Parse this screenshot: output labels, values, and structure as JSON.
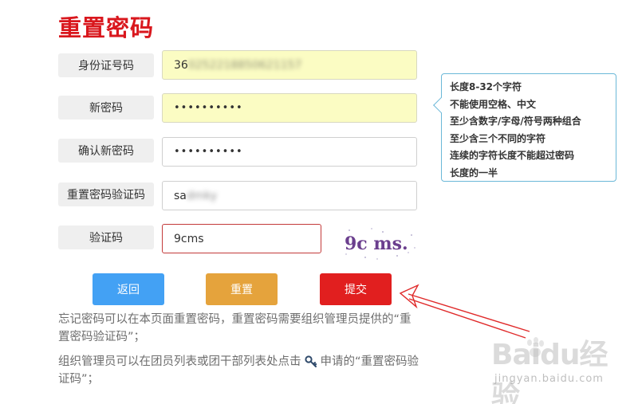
{
  "page": {
    "title": "重置密码"
  },
  "form": {
    "id_card": {
      "label": "身份证号码",
      "value": "36",
      "masked": "0252218850621157"
    },
    "new_password": {
      "label": "新密码",
      "value": "••••••••••"
    },
    "confirm_password": {
      "label": "确认新密码",
      "value": "••••••••••"
    },
    "reset_code": {
      "label": "重置密码验证码",
      "value": "sa",
      "masked": "dmky"
    },
    "captcha": {
      "label": "验证码",
      "value": "9cms",
      "image_text": "9c ms."
    }
  },
  "tooltip": {
    "lines": [
      "长度8-32个字符",
      "不能使用空格、中文",
      "至少含数字/字母/符号两种组合",
      "至少含三个不同的字符",
      "连续的字符长度不能超过密码",
      "长度的一半"
    ]
  },
  "buttons": {
    "back": "返回",
    "reset": "重置",
    "submit": "提交"
  },
  "notes": {
    "note1": "忘记密码可以在本页面重置密码，重置密码需要组织管理员提供的“重置密码验证码”；",
    "note2_before": "组织管理员可以在团员列表或团干部列表处点击",
    "note2_after": "申请的“重置密码验证码”；"
  },
  "watermark": {
    "main": "Baidu经验",
    "sub": "jingyan.baidu.com"
  },
  "colors": {
    "title": "#d9171d",
    "back": "#43a1f4",
    "reset": "#e5a33c",
    "submit": "#e11f1f",
    "highlight": "#fbfcc3",
    "tip_border": "#6bb8d8"
  }
}
